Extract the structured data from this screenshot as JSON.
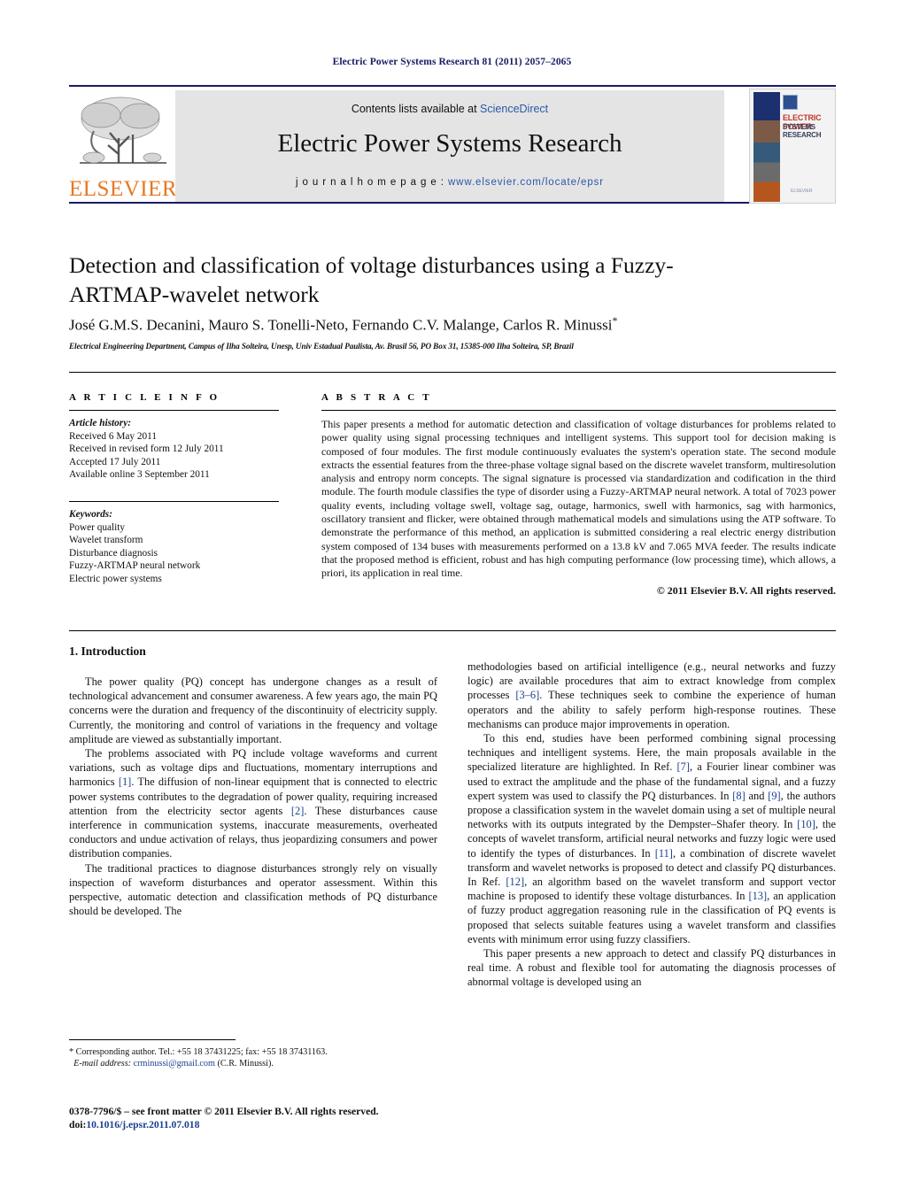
{
  "running_head": "Electric Power Systems Research 81 (2011) 2057–2065",
  "masthead": {
    "contents_prefix": "Contents lists available at ",
    "sciencedirect": "ScienceDirect",
    "journal_name": "Electric Power Systems Research",
    "homepage_label": "j o u r n a l   h o m e p a g e :  ",
    "homepage_url": "www.elsevier.com/locate/epsr",
    "publisher_wordmark": "ELSEVIER",
    "cover_title_line1": "ELECTRIC POWER",
    "cover_title_line2": "SYSTEMS RESEARCH",
    "cover_footer": "ELSEVIER",
    "link_color": "#2b57a8",
    "rule_color": "#1a1a64",
    "elsevier_orange": "#E87722"
  },
  "article": {
    "title": "Detection and classification of voltage disturbances using a Fuzzy-ARTMAP-wavelet network",
    "authors": "José G.M.S. Decanini, Mauro S. Tonelli-Neto, Fernando C.V. Malange, Carlos R. Minussi",
    "corresponding_marker": "*",
    "affiliation": "Electrical Engineering Department, Campus of Ilha Solteira, Unesp, Univ Estadual Paulista, Av. Brasil 56, PO Box 31, 15385-000 Ilha Solteira, SP, Brazil"
  },
  "article_info": {
    "heading": "A R T I C L E   I N F O",
    "history_label": "Article history:",
    "history": [
      "Received 6 May 2011",
      "Received in revised form 12 July 2011",
      "Accepted 17 July 2011",
      "Available online 3 September 2011"
    ],
    "keywords_label": "Keywords:",
    "keywords": [
      "Power quality",
      "Wavelet transform",
      "Disturbance diagnosis",
      "Fuzzy-ARTMAP neural network",
      "Electric power systems"
    ]
  },
  "abstract": {
    "heading": "A B S T R A C T",
    "text": "This paper presents a method for automatic detection and classification of voltage disturbances for problems related to power quality using signal processing techniques and intelligent systems. This support tool for decision making is composed of four modules. The first module continuously evaluates the system's operation state. The second module extracts the essential features from the three-phase voltage signal based on the discrete wavelet transform, multiresolution analysis and entropy norm concepts. The signal signature is processed via standardization and codification in the third module. The fourth module classifies the type of disorder using a Fuzzy-ARTMAP neural network. A total of 7023 power quality events, including voltage swell, voltage sag, outage, harmonics, swell with harmonics, sag with harmonics, oscillatory transient and flicker, were obtained through mathematical models and simulations using the ATP software. To demonstrate the performance of this method, an application is submitted considering a real electric energy distribution system composed of 134 buses with measurements performed on a 13.8 kV and 7.065 MVA feeder. The results indicate that the proposed method is efficient, robust and has high computing performance (low processing time), which allows, a priori, its application in real time.",
    "copyright": "© 2011 Elsevier B.V. All rights reserved."
  },
  "section": {
    "number_and_title": "1.  Introduction"
  },
  "body": {
    "left_paragraphs": [
      "The power quality (PQ) concept has undergone changes as a result of technological advancement and consumer awareness. A few years ago, the main PQ concerns were the duration and frequency of the discontinuity of electricity supply. Currently, the monitoring and control of variations in the frequency and voltage amplitude are viewed as substantially important.",
      "The problems associated with PQ include voltage waveforms and current variations, such as voltage dips and fluctuations, momentary interruptions and harmonics [1]. The diffusion of non-linear equipment that is connected to electric power systems contributes to the degradation of power quality, requiring increased attention from the electricity sector agents [2]. These disturbances cause interference in communication systems, inaccurate measurements, overheated conductors and undue activation of relays, thus jeopardizing consumers and power distribution companies.",
      "The traditional practices to diagnose disturbances strongly rely on visually inspection of waveform disturbances and operator assessment. Within this perspective, automatic detection and classification methods of PQ disturbance should be developed. The"
    ],
    "right_paragraphs": [
      "methodologies based on artificial intelligence (e.g., neural networks and fuzzy logic) are available procedures that aim to extract knowledge from complex processes [3–6]. These techniques seek to combine the experience of human operators and the ability to safely perform high-response routines. These mechanisms can produce major improvements in operation.",
      "To this end, studies have been performed combining signal processing techniques and intelligent systems. Here, the main proposals available in the specialized literature are highlighted. In Ref. [7], a Fourier linear combiner was used to extract the amplitude and the phase of the fundamental signal, and a fuzzy expert system was used to classify the PQ disturbances. In [8] and [9], the authors propose a classification system in the wavelet domain using a set of multiple neural networks with its outputs integrated by the Dempster–Shafer theory. In [10], the concepts of wavelet transform, artificial neural networks and fuzzy logic were used to identify the types of disturbances. In [11], a combination of discrete wavelet transform and wavelet networks is proposed to detect and classify PQ disturbances. In Ref. [12], an algorithm based on the wavelet transform and support vector machine is proposed to identify these voltage disturbances. In [13], an application of fuzzy product aggregation reasoning rule in the classification of PQ events is proposed that selects suitable features using a wavelet transform and classifies events with minimum error using fuzzy classifiers.",
      "This paper presents a new approach to detect and classify PQ disturbances in real time. A robust and flexible tool for automating the diagnosis processes of abnormal voltage is developed using an"
    ]
  },
  "footnotes": {
    "corresponding": "* Corresponding author. Tel.: +55 18 37431225; fax: +55 18 37431163.",
    "email_label": "E-mail address:",
    "email": "crminussi@gmail.com",
    "email_suffix": "(C.R. Minussi).",
    "issn_line": "0378-7796/$ – see front matter © 2011 Elsevier B.V. All rights reserved.",
    "doi_label": "doi:",
    "doi": "10.1016/j.epsr.2011.07.018"
  }
}
